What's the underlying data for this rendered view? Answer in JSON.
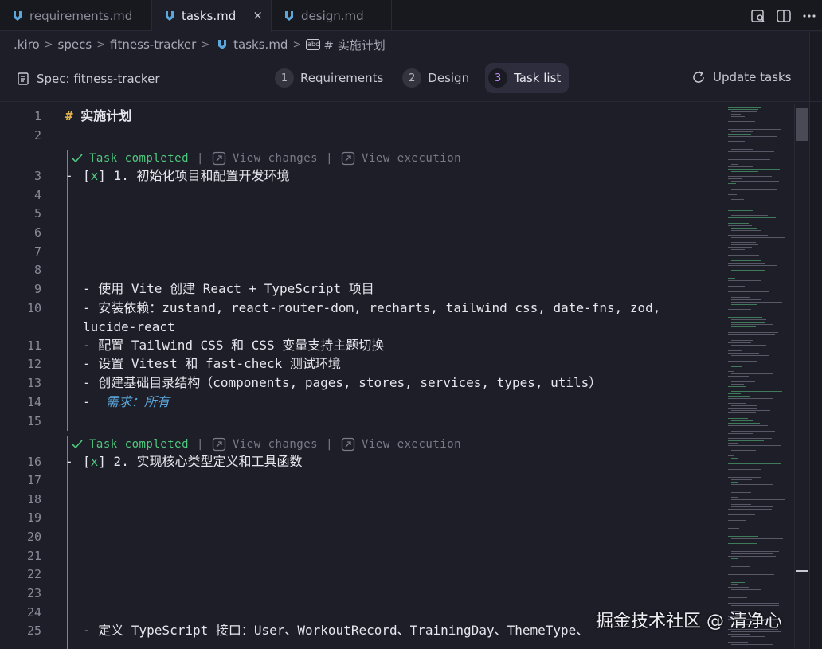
{
  "tabs": [
    {
      "label": "requirements.md",
      "active": false
    },
    {
      "label": "tasks.md",
      "active": true,
      "close": "×"
    },
    {
      "label": "design.md",
      "active": false
    }
  ],
  "breadcrumb": {
    "items": [
      ".kiro",
      "specs",
      "fitness-tracker",
      "tasks.md",
      "# 实施计划"
    ]
  },
  "spec": {
    "title": "Spec: fitness-tracker",
    "steps": [
      {
        "num": "1",
        "label": "Requirements"
      },
      {
        "num": "2",
        "label": "Design"
      },
      {
        "num": "3",
        "label": "Task list"
      }
    ],
    "update_label": "Update tasks"
  },
  "lens": {
    "status": "Task completed",
    "view_changes": "View changes",
    "view_execution": "View execution"
  },
  "editor": {
    "line_numbers": [
      "1",
      "2",
      "3",
      "4",
      "5",
      "6",
      "7",
      "8",
      "9",
      "10",
      "11",
      "12",
      "13",
      "14",
      "15",
      "16",
      "17",
      "18",
      "19",
      "20",
      "21",
      "22",
      "23",
      "24",
      "25"
    ],
    "heading_hash": "#",
    "heading_text": "实施计划",
    "task1": {
      "box_open": "[",
      "mark": "x",
      "box_close": "]",
      "text": " 1. 初始化项目和配置开发环境"
    },
    "task1_items": [
      "- 使用 Vite 创建 React + TypeScript 项目",
      "- 安装依赖：zustand, react-router-dom, recharts, tailwind css, date-fns, zod,",
      "lucide-react",
      "- 配置 Tailwind CSS 和 CSS 变量支持主题切换",
      "- 设置 Vitest 和 fast-check 测试环境",
      "- 创建基础目录结构（components, pages, stores, services, types, utils）"
    ],
    "req_prefix": "- ",
    "req_text": "_需求：所有_",
    "task2": {
      "box_open": "[",
      "mark": "x",
      "box_close": "]",
      "text": " 2. 实现核心类型定义和工具函数"
    },
    "task2_item": "- 定义 TypeScript 接口：User、WorkoutRecord、TrainingDay、ThemeType、",
    "dash": "-"
  },
  "watermark": "掘金技术社区 @ 清净心",
  "colors": {
    "accent": "#b48cf2",
    "success": "#4ec97f",
    "link": "#5ba7dc",
    "heading_hash": "#e0b34a"
  }
}
